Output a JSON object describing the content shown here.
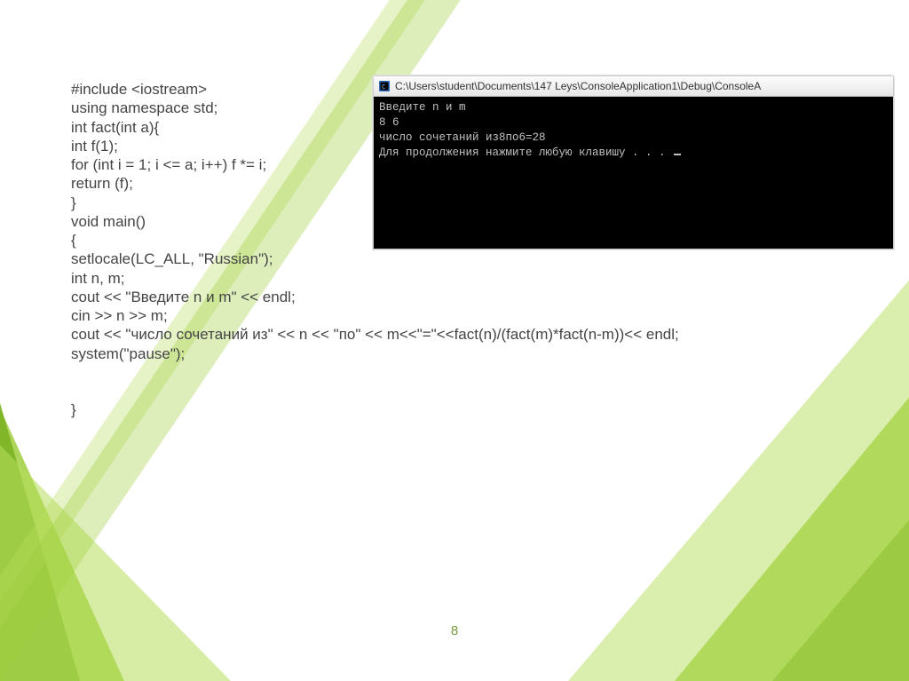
{
  "code": {
    "lines": [
      "#include <iostream>",
      "using namespace std;",
      "int fact(int a){",
      "int f(1);",
      "for (int i = 1; i <= a; i++) f *= i;",
      "return (f);",
      "}",
      "void main()",
      "{",
      "setlocale(LC_ALL, \"Russian\");",
      "int n, m;",
      "cout << \"Введите n и m\" << endl;",
      "cin >> n >> m;",
      "cout << \"число сочетаний из\" << n << \"по\" << m<<\"=\"<<fact(n)/(fact(m)*fact(n-m))<< endl;",
      "system(\"pause\");",
      "",
      "",
      "}"
    ]
  },
  "console": {
    "icon_name": "cpp-console-icon",
    "title": "C:\\Users\\student\\Documents\\147 Leys\\ConsoleApplication1\\Debug\\ConsoleA",
    "output": [
      "Введите n и m",
      "8 6",
      "число сочетаний из8по6=28",
      "Для продолжения нажмите любую клавишу . . . "
    ]
  },
  "page_number": "8",
  "colors": {
    "accent_green_light": "#a8d44a",
    "accent_green_dark": "#6fa61f"
  }
}
